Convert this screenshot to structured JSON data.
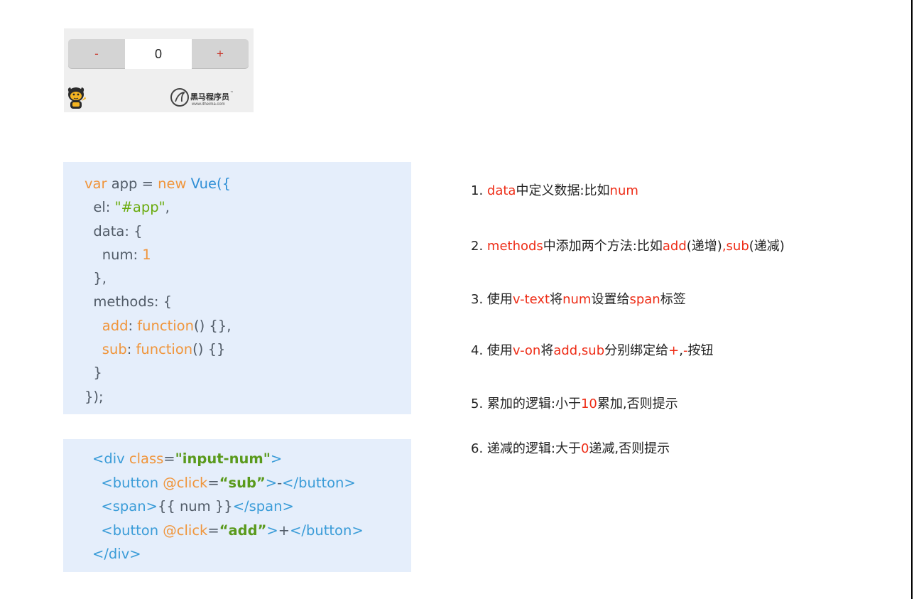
{
  "widget": {
    "minus_label": "-",
    "value": "0",
    "plus_label": "+",
    "logo_text": "黑马程序员",
    "logo_tm": "™",
    "logo_url": "www.itheima.com"
  },
  "code_js": {
    "l1_var": "var",
    "l1_mid": " app = ",
    "l1_new": "new",
    "l1_vue": " Vue",
    "l1_end": "({",
    "l2_key": "  el: ",
    "l2_val": "\"#app\"",
    "l2_end": ",",
    "l3": "  data: {",
    "l4_key": "    num: ",
    "l4_val": "1",
    "l5": "  },",
    "l6": "  methods: {",
    "l7_key": "add",
    "l7_colon": ": ",
    "l7_fn": "function",
    "l7_end": "() {},",
    "l8_key": "sub",
    "l8_colon": ": ",
    "l8_fn": "function",
    "l8_end": "() {}",
    "l9": "  }",
    "l10": "});"
  },
  "code_html": {
    "l1_open": "<div ",
    "l1_attr": "class",
    "l1_eq": "=",
    "l1_val": "\"input-num\"",
    "l1_close": ">",
    "l2_open": "<button ",
    "l2_attr": "@click",
    "l2_eq": "=",
    "l2_val": "“sub”",
    "l2_gt": ">",
    "l2_text": "-",
    "l2_close": "</button>",
    "l3_open": "<span>",
    "l3_text": "{{ num }}",
    "l3_close": "</span>",
    "l4_open": "<button ",
    "l4_attr": "@click",
    "l4_eq": "=",
    "l4_val": "“add”",
    "l4_gt": ">",
    "l4_text": "+",
    "l4_close": "</button>",
    "l5": "</div>"
  },
  "steps": [
    {
      "segments": [
        {
          "text": "1. ",
          "hl": false
        },
        {
          "text": "data",
          "hl": true
        },
        {
          "text": "中定义数据:比如",
          "hl": false
        },
        {
          "text": "num",
          "hl": true
        }
      ]
    },
    {
      "segments": [
        {
          "text": "2. ",
          "hl": false
        },
        {
          "text": "methods",
          "hl": true
        },
        {
          "text": "中添加两个方法:比如",
          "hl": false
        },
        {
          "text": "add",
          "hl": true
        },
        {
          "text": "(递增)",
          "hl": false
        },
        {
          "text": ",sub",
          "hl": true
        },
        {
          "text": "(递减)",
          "hl": false
        }
      ]
    },
    {
      "segments": [
        {
          "text": "3. 使用",
          "hl": false
        },
        {
          "text": "v-text",
          "hl": true
        },
        {
          "text": "将",
          "hl": false
        },
        {
          "text": "num",
          "hl": true
        },
        {
          "text": "设置给",
          "hl": false
        },
        {
          "text": "span",
          "hl": true
        },
        {
          "text": "标签",
          "hl": false
        }
      ]
    },
    {
      "segments": [
        {
          "text": "4. 使用",
          "hl": false
        },
        {
          "text": "v-on",
          "hl": true
        },
        {
          "text": "将",
          "hl": false
        },
        {
          "text": "add,sub",
          "hl": true
        },
        {
          "text": "分别绑定给",
          "hl": false
        },
        {
          "text": "+",
          "hl": true
        },
        {
          "text": ",",
          "hl": false
        },
        {
          "text": "-",
          "hl": true
        },
        {
          "text": "按钮",
          "hl": false
        }
      ]
    },
    {
      "segments": [
        {
          "text": "5. 累加的逻辑:小于",
          "hl": false
        },
        {
          "text": "10",
          "hl": true
        },
        {
          "text": "累加,否则提示",
          "hl": false
        }
      ]
    },
    {
      "segments": [
        {
          "text": "6. 递减的逻辑:大于",
          "hl": false
        },
        {
          "text": "0",
          "hl": true
        },
        {
          "text": "递减,否则提示",
          "hl": false
        }
      ]
    }
  ],
  "colors": {
    "highlight": "#ee2d17",
    "code_bg": "#e5eefb",
    "widget_bg": "#efefef",
    "button_text": "#c8392e"
  },
  "icons": {
    "mascot": "mascot-icon",
    "logo": "itheima-logo-icon"
  }
}
